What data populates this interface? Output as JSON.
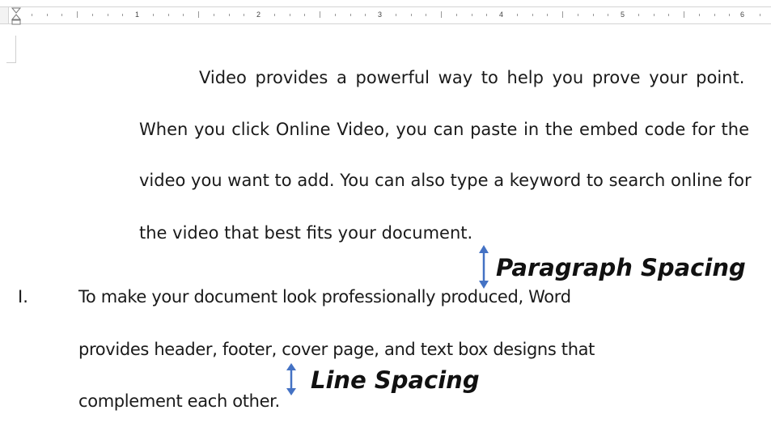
{
  "ruler": {
    "numbers": [
      "1",
      "2",
      "3",
      "4",
      "5",
      "6"
    ]
  },
  "paragraph": {
    "lines": [
      "Video provides a powerful way to help you prove your point.",
      "When you click Online Video, you can paste in the embed code for the",
      "video you want to add. You can also type a keyword to search online for",
      "the video that best fits your document."
    ]
  },
  "list_item": {
    "marker": "I.",
    "lines": [
      "To make your document look professionally produced, Word",
      "provides header, footer, cover page, and text box designs that",
      "complement each other."
    ]
  },
  "annotations": {
    "paragraph_spacing": "Paragraph Spacing",
    "line_spacing": "Line Spacing",
    "arrow_color": "#4472c4"
  }
}
